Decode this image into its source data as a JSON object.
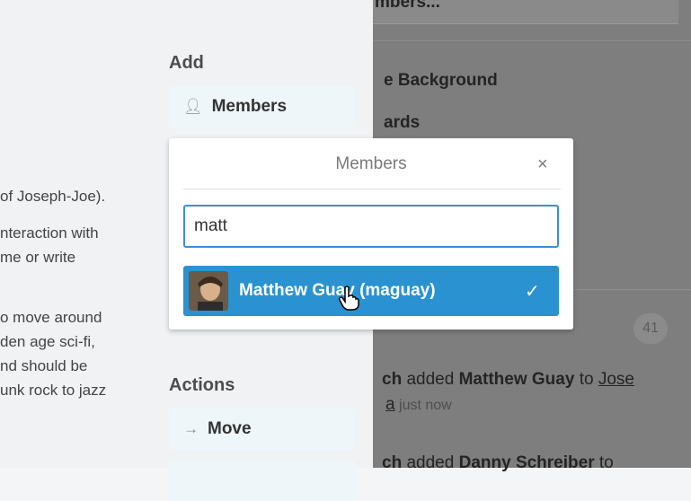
{
  "left": {
    "description_lines": [
      "of Joseph-Joe).",
      "nteraction with",
      "me or write",
      "o move around",
      "den age sci-fi,",
      "nd should be",
      "unk rock to jazz"
    ],
    "add_heading": "Add",
    "members_button": "Members",
    "actions_heading": "Actions",
    "move_button": "Move"
  },
  "right": {
    "top_label": "mbers...",
    "change_background": "e Background",
    "cards_label": "ards",
    "activity_count": "41",
    "activity1_actor": "ch",
    "activity1_action": "added",
    "activity1_member": "Matthew Guay",
    "activity1_to": "to",
    "activity1_card": "Jose",
    "activity1_card_line2": "a",
    "activity1_time": "just now",
    "activity2_actor": "ch",
    "activity2_action": "added",
    "activity2_member": "Danny Schreiber",
    "activity2_to": "to"
  },
  "popup": {
    "title": "Members",
    "close_symbol": "×",
    "search_value": "matt",
    "result_name": "Matthew Guay (maguay)",
    "check_symbol": "✓"
  }
}
